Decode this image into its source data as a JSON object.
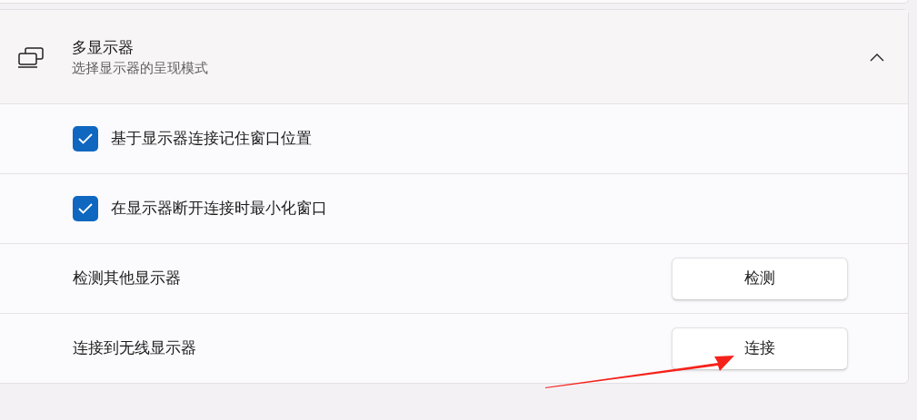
{
  "section": {
    "title": "多显示器",
    "subtitle": "选择显示器的呈现模式",
    "expanded": true
  },
  "rows": [
    {
      "kind": "checkbox",
      "label": "基于显示器连接记住窗口位置",
      "checked": true
    },
    {
      "kind": "checkbox",
      "label": "在显示器断开连接时最小化窗口",
      "checked": true
    },
    {
      "kind": "button",
      "label": "检测其他显示器",
      "button": "检测"
    },
    {
      "kind": "button",
      "label": "连接到无线显示器",
      "button": "连接"
    }
  ]
}
